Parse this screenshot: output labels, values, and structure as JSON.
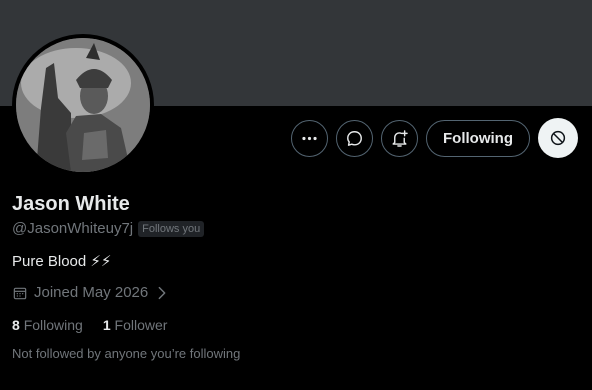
{
  "profile": {
    "name": "Jason White",
    "handle": "@JasonWhiteuy7j",
    "follows_you_badge": "Follows you",
    "bio": "Pure Blood ⚡⚡",
    "joined": "Joined May 2026",
    "following_count": "8",
    "following_label": "Following",
    "followers_count": "1",
    "followers_label": "Follower",
    "not_followed_note": "Not followed by anyone you’re following"
  },
  "actions": {
    "following_button": "Following",
    "more_icon": "more-icon",
    "message_icon": "message-icon",
    "notify_icon": "bell-plus-icon",
    "block_icon": "block-icon"
  },
  "colors": {
    "banner": "#333639",
    "background": "#000000",
    "muted_text": "#71767b",
    "primary_text": "#e7e9ea"
  }
}
